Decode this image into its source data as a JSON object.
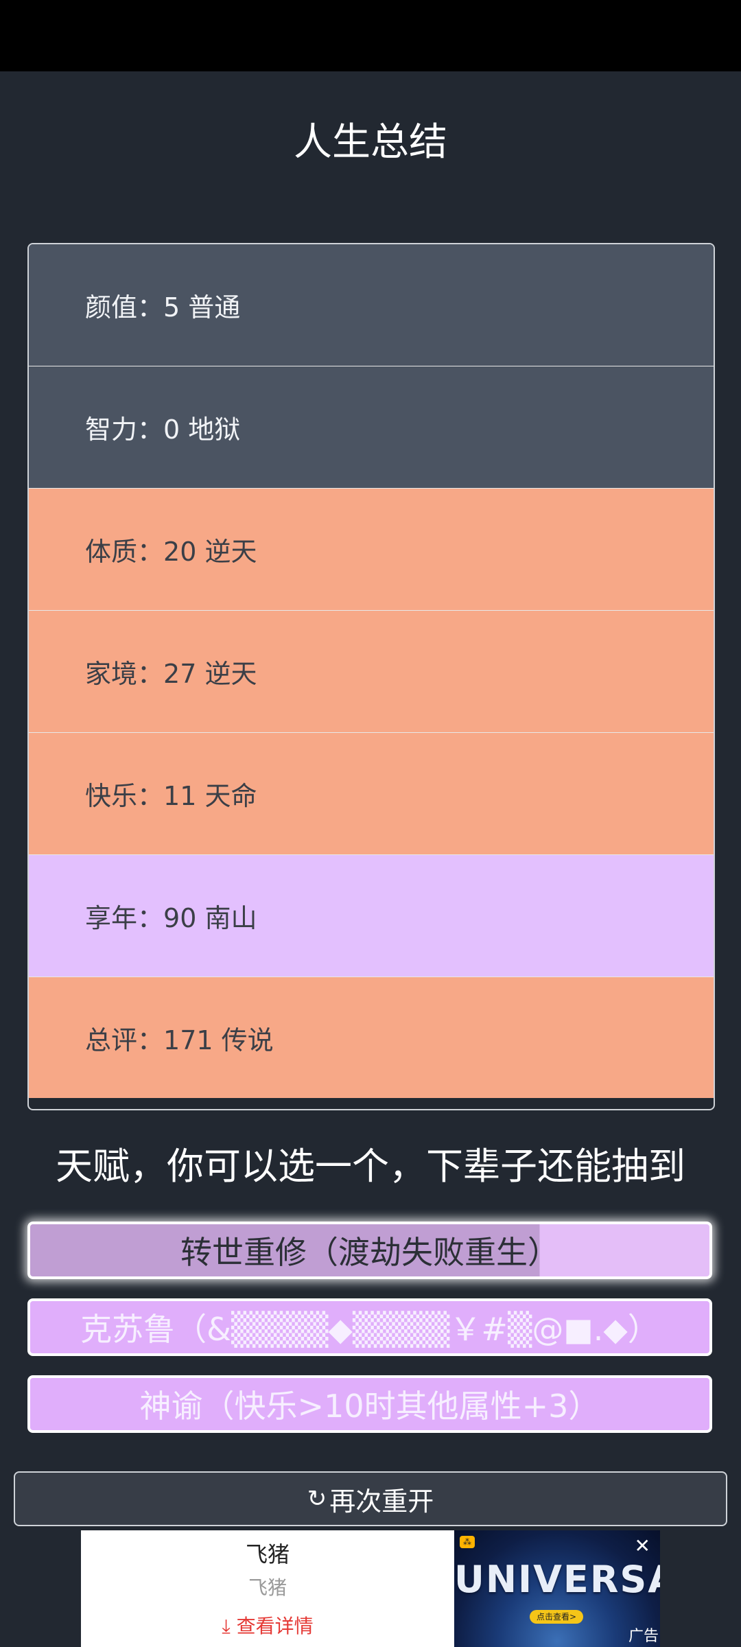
{
  "header": {
    "title": "人生总结"
  },
  "summary": [
    {
      "label": "颜值：",
      "value": "5 普通",
      "grade": "common"
    },
    {
      "label": "智力：",
      "value": "0 地狱",
      "grade": "common"
    },
    {
      "label": "体质：",
      "value": "20 逆天",
      "grade": "legend"
    },
    {
      "label": "家境：",
      "value": "27 逆天",
      "grade": "legend"
    },
    {
      "label": "快乐：",
      "value": "11 天命",
      "grade": "legend"
    },
    {
      "label": "享年：",
      "value": "90 南山",
      "grade": "rare"
    },
    {
      "label": "总评：",
      "value": "171 传说",
      "grade": "legend"
    }
  ],
  "talent_heading": "天赋，你可以选一个，下辈子还能抽到",
  "talents": [
    {
      "text": "转世重修（渡劫失败重生）",
      "selected": true
    },
    {
      "text": "克苏鲁（&▒▒▒▒◆▒▒▒▒￥#▒@■.◆）",
      "selected": false
    },
    {
      "text": "神谕（快乐>10时其他属性+3）",
      "selected": false
    }
  ],
  "restart": {
    "icon": "refresh-icon",
    "label": "再次重开"
  },
  "ad": {
    "title": "飞猪",
    "subtitle": "飞猪",
    "cta": "查看详情",
    "image_text": "UNIVERSAL",
    "image_cta": "点击查看>",
    "label": "广告"
  },
  "colors": {
    "background": "#222831",
    "common": "#4b5462",
    "legend": "#f7a887",
    "rare": "#e3c0fe",
    "talent": "#e0aefb"
  }
}
